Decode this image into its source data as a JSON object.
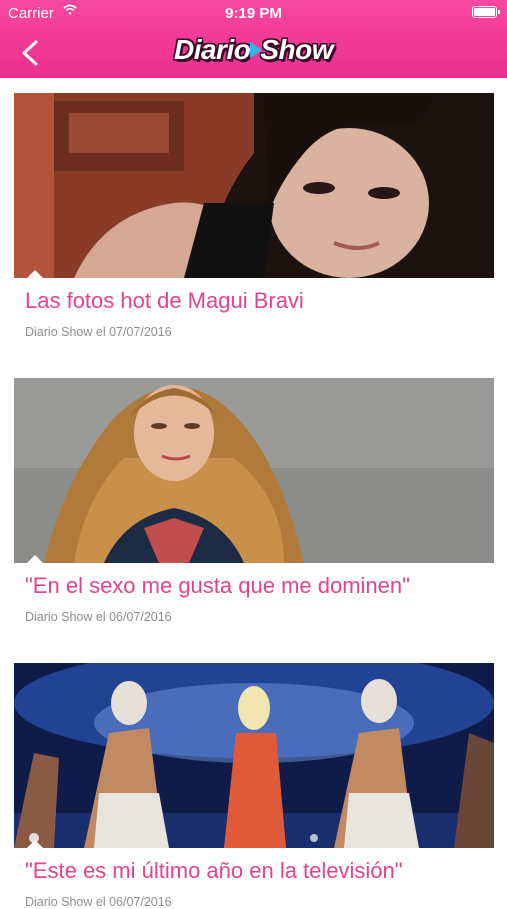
{
  "status_bar": {
    "carrier": "Carrier",
    "time": "9:19 PM"
  },
  "app": {
    "logo_left": "Diario",
    "logo_right": "Show"
  },
  "colors": {
    "header_top": "#f7489f",
    "header_bottom": "#ec2f8d",
    "title": "#e0458e",
    "meta": "#8e8e8e"
  },
  "articles": [
    {
      "title": "Las fotos hot de Magui Bravi",
      "meta": "Diario Show el 07/07/2016"
    },
    {
      "title": "\"En el sexo me gusta que me dominen\"",
      "meta": "Diario Show el 06/07/2016"
    },
    {
      "title": "\"Este es mi último año en la televisión\"",
      "meta": "Diario Show el 06/07/2016"
    }
  ]
}
